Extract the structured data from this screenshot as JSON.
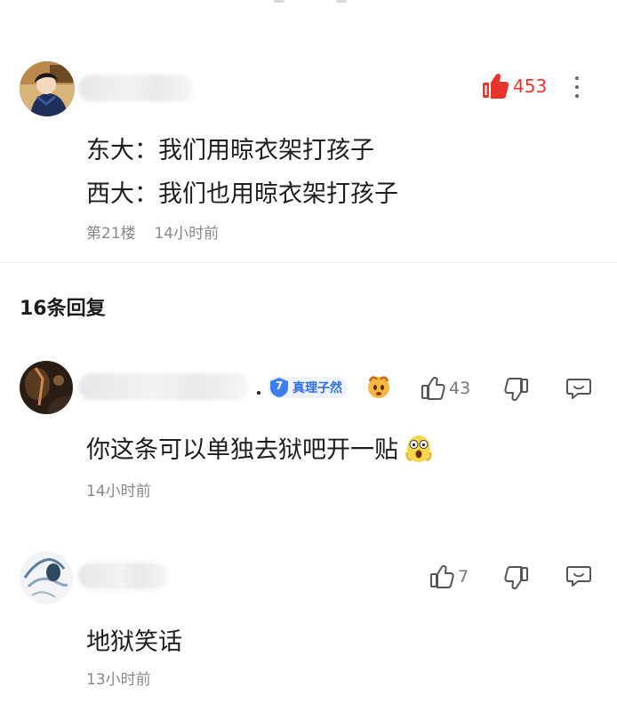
{
  "main_post": {
    "likes": "453",
    "lines": [
      "东大：我们用晾衣架打孩子",
      "西大：我们也用晾衣架打孩子"
    ],
    "floor": "第21楼",
    "time": "14小时前",
    "like_color": "#e8352b"
  },
  "replies_header": "16条回复",
  "replies": [
    {
      "badge_level": "7",
      "badge_text": "真理子然",
      "likes": "43",
      "text": "你这条可以单独去狱吧开一贴",
      "time": "14小时前"
    },
    {
      "likes": "7",
      "text": "地狱笑话",
      "time": "13小时前"
    }
  ]
}
